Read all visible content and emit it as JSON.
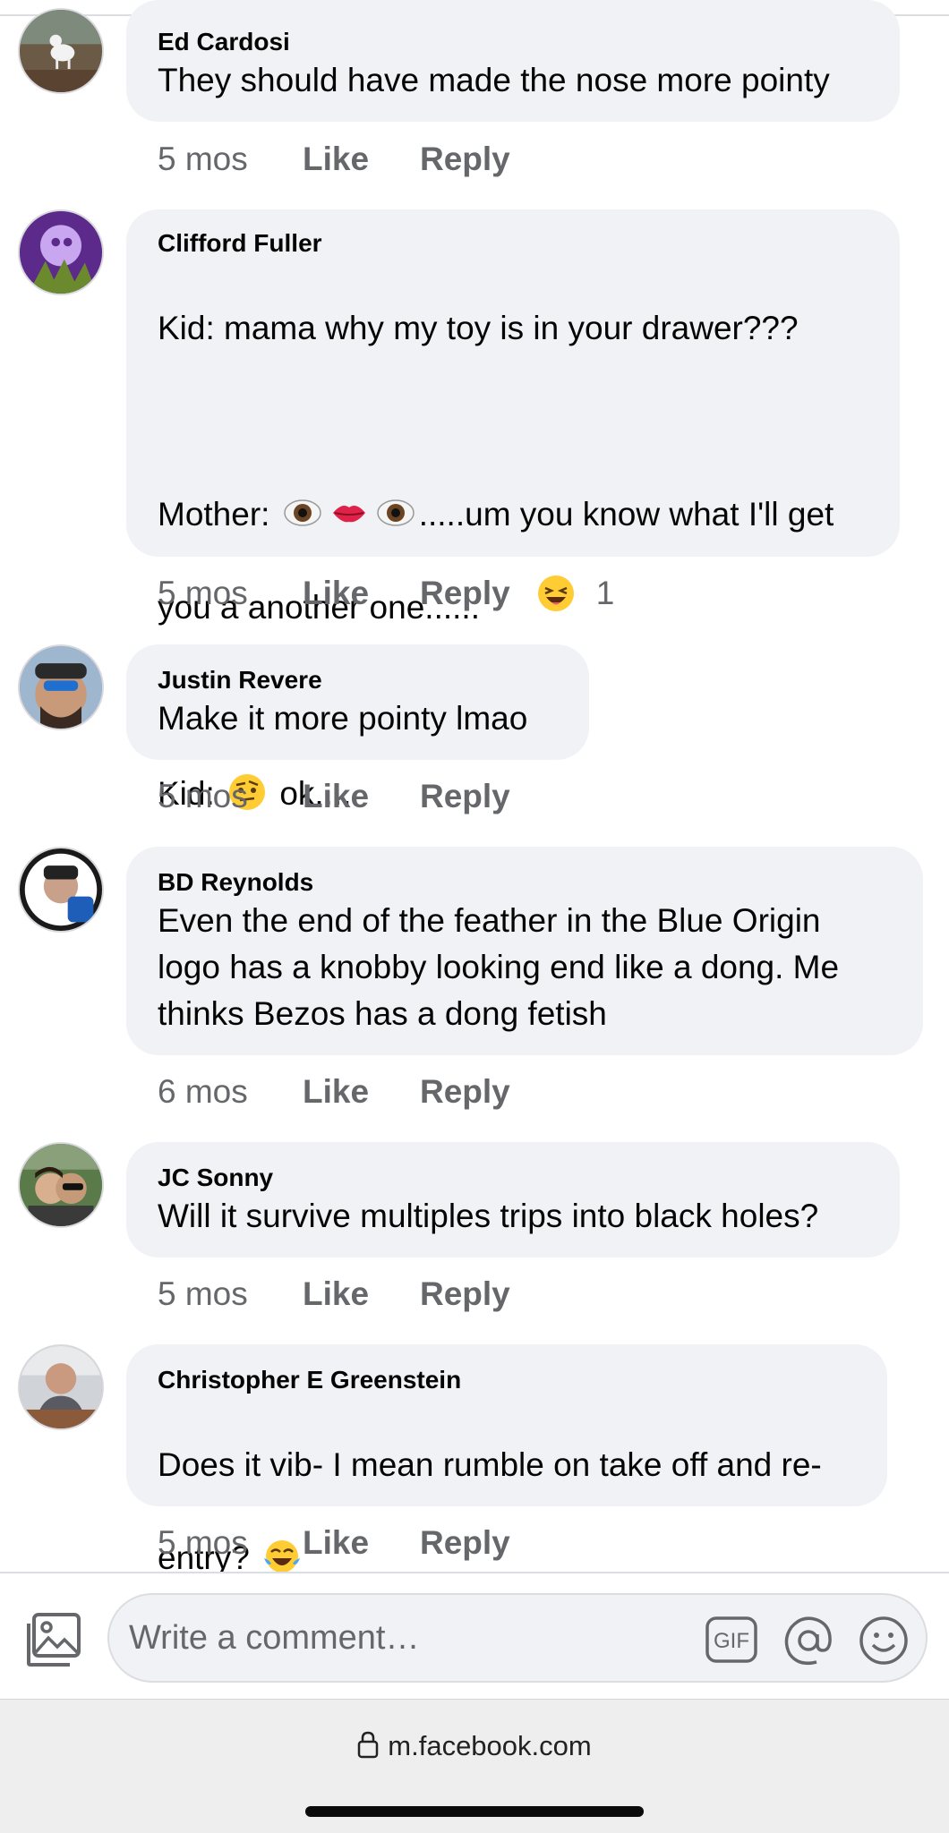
{
  "comments": [
    {
      "author": "Ed Cardosi",
      "text": "They should have made the nose more pointy",
      "time": "5 mos",
      "like_label": "Like",
      "reply_label": "Reply"
    },
    {
      "author": "Clifford Fuller",
      "line1": "Kid: mama why my toy is in your drawer???",
      "line2_prefix": "Mother: ",
      "line2_suffix": ".....um you know what I'll get",
      "line3": "you a another one......",
      "line4_prefix": "Kid: ",
      "line4_suffix": " ok....",
      "emoji_icons": [
        "eyes-emoji",
        "lips-emoji",
        "eye-emoji",
        "raised-eyebrow-emoji"
      ],
      "time": "5 mos",
      "like_label": "Like",
      "reply_label": "Reply",
      "reaction_icon": "laughing-squint-emoji",
      "reaction_count": "1"
    },
    {
      "author": "Justin Revere",
      "text": "Make it more pointy lmao",
      "time": "5 mos",
      "like_label": "Like",
      "reply_label": "Reply"
    },
    {
      "author": "BD Reynolds",
      "text": "Even the end of the feather in the Blue Origin\nlogo has a knobby looking end like a dong.  Me\nthinks Bezos has a dong fetish",
      "time": "6 mos",
      "like_label": "Like",
      "reply_label": "Reply"
    },
    {
      "author": "JC Sonny",
      "text": "Will it survive multiples trips into black holes?",
      "time": "5 mos",
      "like_label": "Like",
      "reply_label": "Reply"
    },
    {
      "author": "Christopher E Greenstein",
      "line1": "Does it vib- I mean rumble on take off and re-",
      "line2": "entry?  ",
      "emoji_icons": [
        "tears-of-joy-emoji"
      ],
      "time": "5 mos",
      "like_label": "Like",
      "reply_label": "Reply"
    }
  ],
  "composer": {
    "placeholder": "Write a comment…",
    "gif_label": "GIF",
    "icons": [
      "photo-icon",
      "gif-icon",
      "at-mention-icon",
      "emoji-icon"
    ]
  },
  "browser": {
    "url": "m.facebook.com",
    "icon": "lock-icon"
  },
  "colors": {
    "bubble": "#f0f2f5",
    "text": "#050505",
    "secondary": "#65676b",
    "browser_bar": "#eeeeef"
  }
}
